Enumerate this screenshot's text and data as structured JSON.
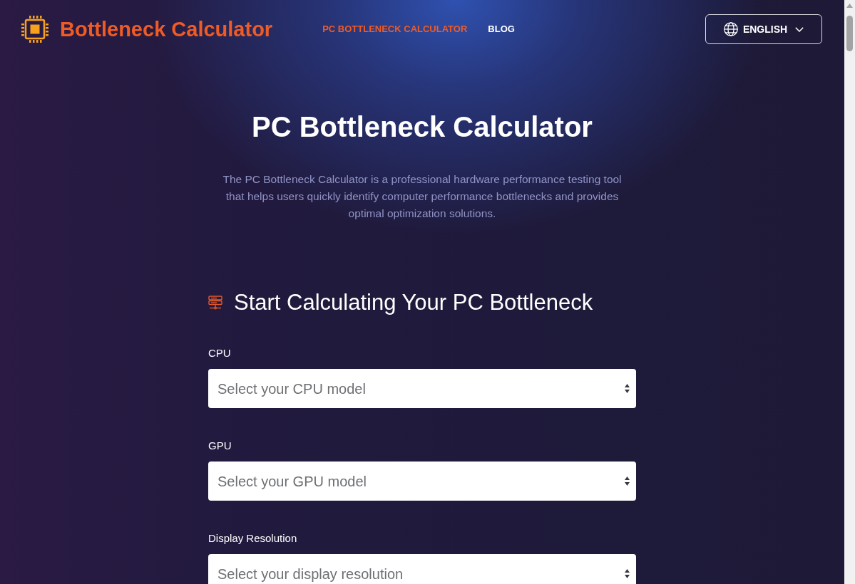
{
  "header": {
    "brand": "Bottleneck Calculator",
    "nav": [
      {
        "label": "PC BOTTLENECK CALCULATOR",
        "selected": true
      },
      {
        "label": "BLOG",
        "selected": false
      }
    ],
    "language": "ENGLISH"
  },
  "hero": {
    "title": "PC Bottleneck Calculator",
    "description": "The PC Bottleneck Calculator is a professional hardware performance testing tool that helps users quickly identify computer performance bottlenecks and provides optimal optimization solutions."
  },
  "calculator": {
    "title": "Start Calculating Your PC Bottleneck",
    "fields": [
      {
        "label": "CPU",
        "placeholder": "Select your CPU model"
      },
      {
        "label": "GPU",
        "placeholder": "Select your GPU model"
      },
      {
        "label": "Display Resolution",
        "placeholder": "Select your display resolution"
      }
    ]
  }
}
